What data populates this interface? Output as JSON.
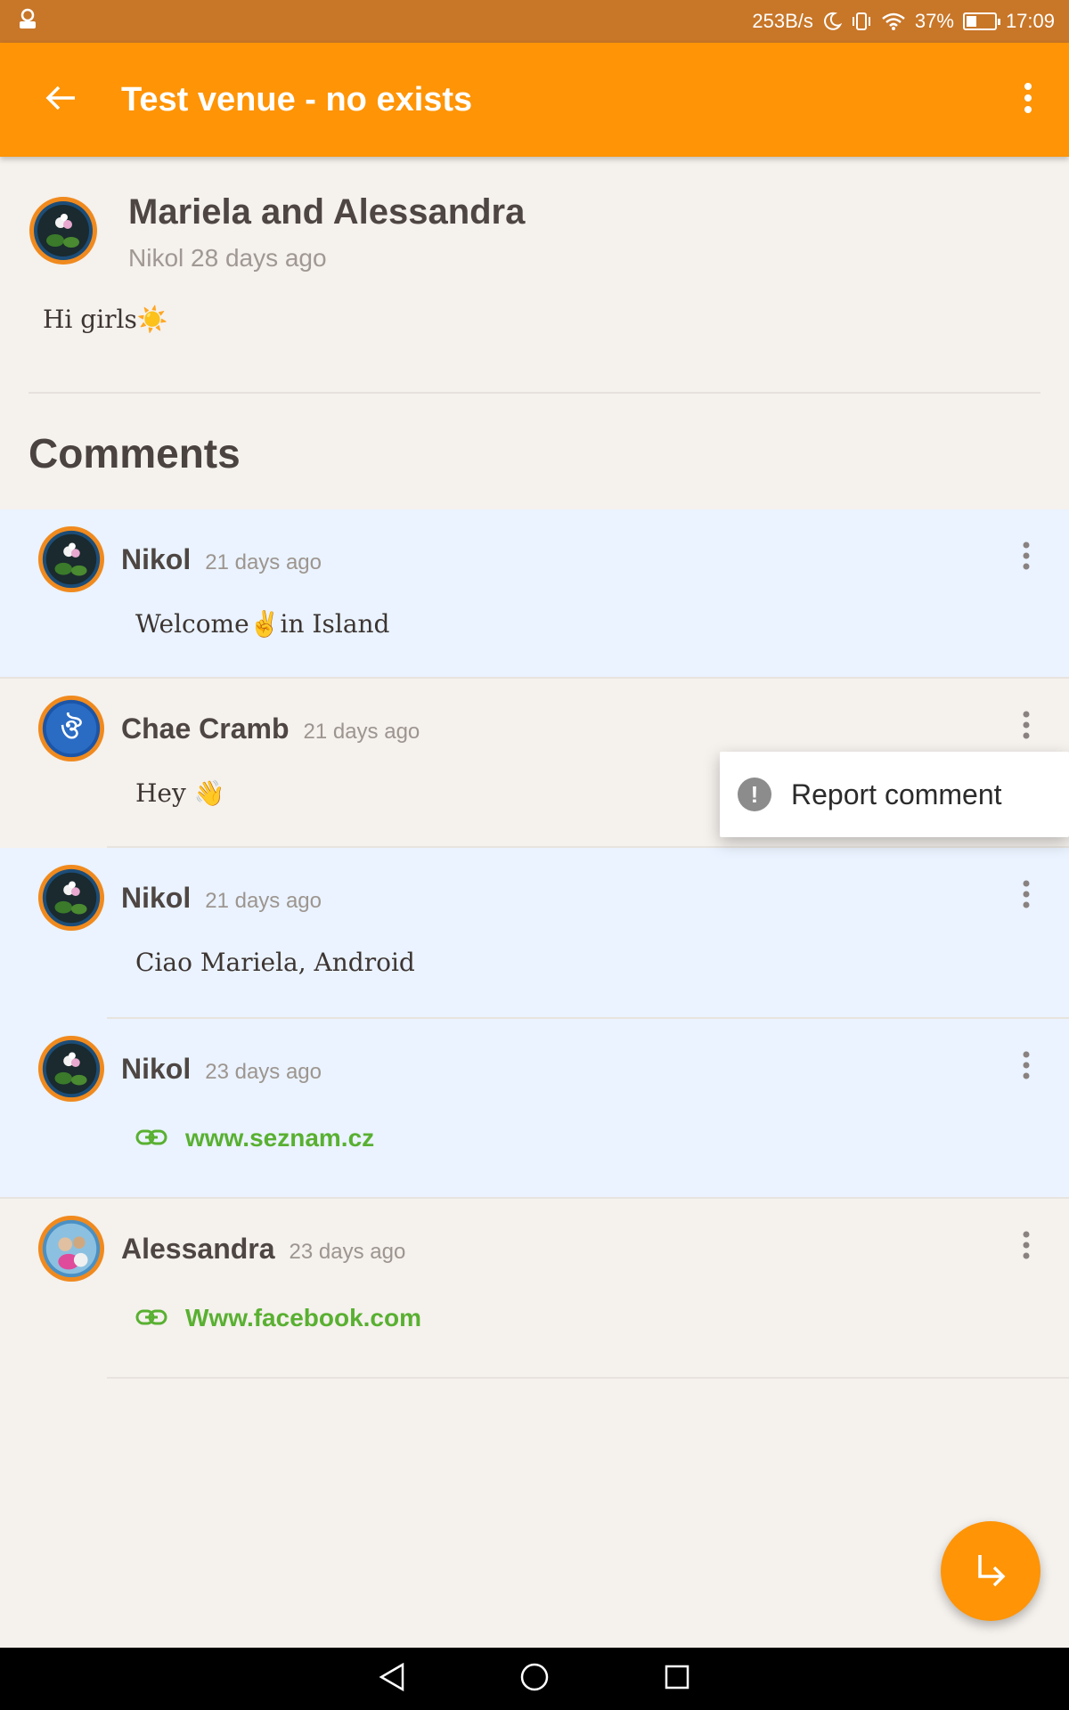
{
  "status_bar": {
    "net_speed": "253B/s",
    "battery": "37%",
    "battery_level": 0.37,
    "time": "17:09"
  },
  "app_bar": {
    "title": "Test venue - no exists"
  },
  "post": {
    "title": "Mariela and Alessandra",
    "author": "Nikol",
    "time": "28 days ago",
    "body": "Hi girls☀️"
  },
  "comments_heading": "Comments",
  "comments": [
    {
      "author": "Nikol",
      "time": "21 days ago",
      "text": "Welcome✌️in Island"
    },
    {
      "author": "Chae Cramb",
      "time": "21 days ago",
      "text": "Hey 👋"
    },
    {
      "author": "Nikol",
      "time": "21 days ago",
      "text": "Ciao Mariela, Android"
    },
    {
      "author": "Nikol",
      "time": "23 days ago",
      "link": "www.seznam.cz"
    },
    {
      "author": "Alessandra",
      "time": "23 days ago",
      "link": "Www.facebook.com"
    }
  ],
  "popup": {
    "report_label": "Report comment"
  },
  "icons": {
    "back": "arrow-left-icon",
    "overflow": "more-vert-icon",
    "link": "link-icon",
    "warning": "alert-circle-icon",
    "fab": "reply-arrow-icon"
  },
  "colors": {
    "status_bar": "#c87628",
    "app_bar": "#fe9406",
    "comment_highlight": "#eaf3ff",
    "background": "#f5f1ed",
    "link": "#59b031"
  }
}
